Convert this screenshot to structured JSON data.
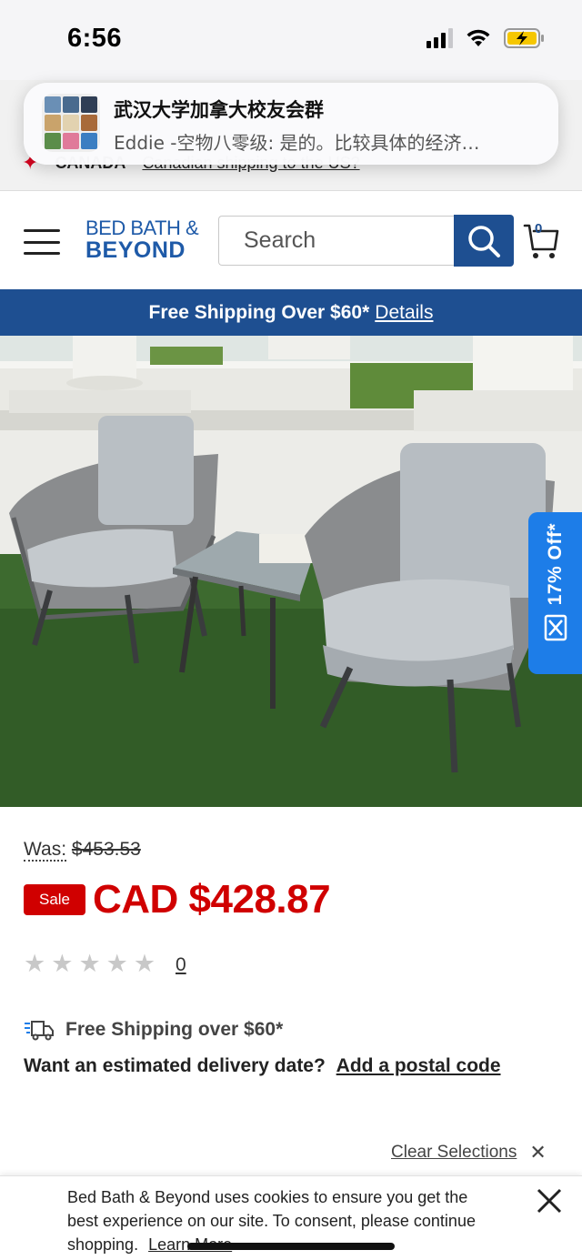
{
  "status_bar": {
    "time": "6:56",
    "icons": [
      "signal-icon",
      "wifi-icon",
      "battery-charging-icon"
    ]
  },
  "notification": {
    "title": "武汉大学加拿大校友会群",
    "body": "Eddie -空物八零级: 是的。比较具体的经济…"
  },
  "country_bar": {
    "country": "CANADA",
    "link": "Canadian shipping to the US?"
  },
  "header": {
    "logo_line1": "BED BATH &",
    "logo_line2": "BEYOND",
    "search_placeholder": "Search",
    "cart_count": "0",
    "brand_color": "#1e4f91"
  },
  "promo": {
    "text": "Free Shipping Over $60*",
    "link": "Details"
  },
  "product": {
    "image_icon": "patio-chairs-table-photo",
    "discount_tab": "17% Off*",
    "was_label": "Was:",
    "was_price": "$453.53",
    "sale_badge": "Sale",
    "sale_price": "CAD $428.87",
    "rating_stars": 0,
    "rating_max": 5,
    "review_count": "0",
    "sale_color": "#d00000"
  },
  "shipping": {
    "free_shipping": "Free Shipping over $60*",
    "delivery_question": "Want an estimated delivery date?",
    "postal_link": "Add a postal code"
  },
  "selections": {
    "clear_label": "Clear Selections",
    "close_icon": "close-icon"
  },
  "cookie": {
    "text": "Bed Bath & Beyond uses cookies to ensure you get the best experience on our site. To consent, please continue shopping.",
    "learn_more": "Learn More"
  }
}
